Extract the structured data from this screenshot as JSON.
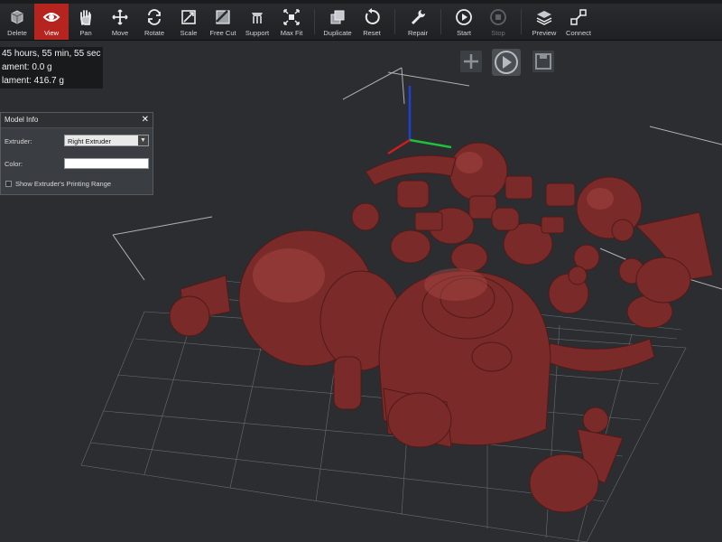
{
  "toolbar": {
    "items": [
      {
        "label": "Delete",
        "icon": "delete-icon"
      },
      {
        "label": "View",
        "icon": "eye-icon",
        "active": true
      },
      {
        "label": "Pan",
        "icon": "hand-icon"
      },
      {
        "label": "Move",
        "icon": "move-icon"
      },
      {
        "label": "Rotate",
        "icon": "rotate-icon"
      },
      {
        "label": "Scale",
        "icon": "scale-icon"
      },
      {
        "label": "Free Cut",
        "icon": "cut-icon"
      },
      {
        "label": "Support",
        "icon": "support-icon"
      },
      {
        "label": "Max Fit",
        "icon": "maxfit-icon"
      },
      {
        "label": "Duplicate",
        "icon": "duplicate-icon"
      },
      {
        "label": "Reset",
        "icon": "reset-icon"
      },
      {
        "label": "Repair",
        "icon": "wrench-icon"
      },
      {
        "label": "Start",
        "icon": "play-icon"
      },
      {
        "label": "Stop",
        "icon": "stop-icon",
        "disabled": true
      },
      {
        "label": "Preview",
        "icon": "layers-icon"
      },
      {
        "label": "Connect",
        "icon": "connect-icon"
      }
    ]
  },
  "stats": {
    "line1": "45 hours, 55 min, 55 sec",
    "line2": "ament: 0.0 g",
    "line3": "lament: 416.7 g"
  },
  "model_info": {
    "title": "Model Info",
    "close": "✕",
    "extruder_label": "Extruder:",
    "extruder_value": "Right Extruder",
    "color_label": "Color:",
    "color_value": "#ffffff",
    "range_label": "Show Extruder's Printing Range"
  },
  "colors": {
    "model": "#7a2a28",
    "background": "#2b2d30",
    "active_tool": "#b5241f"
  }
}
